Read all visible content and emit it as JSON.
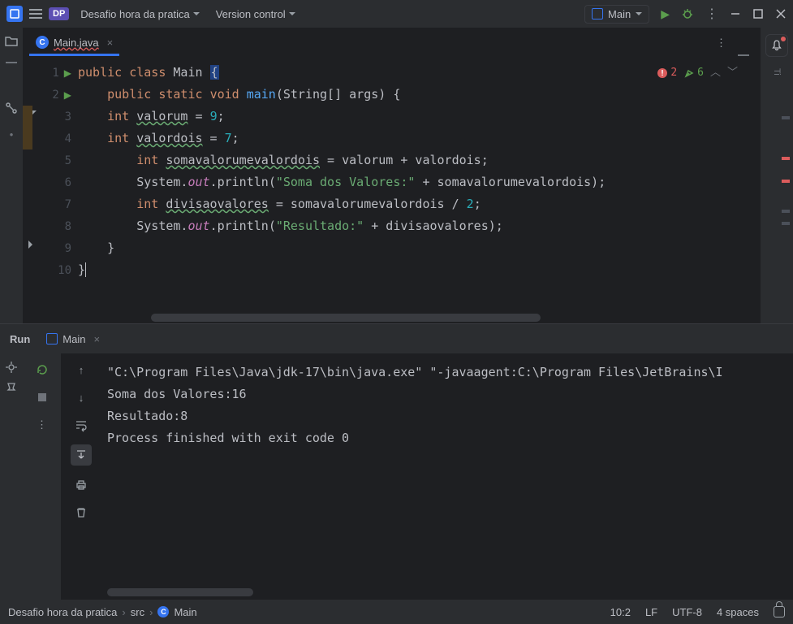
{
  "titlebar": {
    "project_badge": "DP",
    "project_name": "Desafio hora da pratica",
    "version_control": "Version control",
    "run_config": "Main"
  },
  "editor": {
    "tab_name": "Main.java",
    "inspection": {
      "errors": "2",
      "warnings": "6"
    },
    "ti_label": "Ti",
    "lines": [
      {
        "n": "1",
        "run": true
      },
      {
        "n": "2",
        "run": true
      },
      {
        "n": "3"
      },
      {
        "n": "4"
      },
      {
        "n": "5"
      },
      {
        "n": "6"
      },
      {
        "n": "7"
      },
      {
        "n": "8"
      },
      {
        "n": "9"
      },
      {
        "n": "10"
      }
    ],
    "code": {
      "l1": {
        "kw1": "public",
        "kw2": "class",
        "cls": "Main",
        "br": "{"
      },
      "l2": {
        "kw1": "public",
        "kw2": "static",
        "kw3": "void",
        "mth": "main",
        "sig": "(String[] args) {"
      },
      "l3": {
        "kw": "int",
        "var": "valorum",
        "eq": " = ",
        "num": "9",
        "sc": ";"
      },
      "l4": {
        "kw": "int",
        "var": "valordois",
        "eq": " = ",
        "num": "7",
        "sc": ";"
      },
      "l5": {
        "kw": "int",
        "var": "somavalorumevalordois",
        "eq": " = valorum + valordois;"
      },
      "l6": {
        "sys": "System.",
        "out": "out",
        "dot": ".",
        "pl": "println",
        "op": "(",
        "str": "\"Soma dos Valores:\"",
        "rest": " + somavalorumevalordois);"
      },
      "l7": {
        "kw": "int",
        "var": "divisaovalores",
        "eq": " = somavalorumevalordois / ",
        "num": "2",
        "sc": ";"
      },
      "l8": {
        "sys": "System.",
        "out": "out",
        "dot": ".",
        "pl": "println",
        "op": "(",
        "str": "\"Resultado:\"",
        "rest": " + divisaovalores);"
      },
      "l9": {
        "br": "}"
      },
      "l10": {
        "br": "}"
      }
    }
  },
  "run_panel": {
    "title": "Run",
    "tab": "Main",
    "output": [
      "\"C:\\Program Files\\Java\\jdk-17\\bin\\java.exe\" \"-javaagent:C:\\Program Files\\JetBrains\\I",
      "Soma dos Valores:16",
      "Resultado:8",
      "",
      "Process finished with exit code 0"
    ]
  },
  "statusbar": {
    "crumbs": [
      "Desafio hora da pratica",
      "src",
      "Main"
    ],
    "pos": "10:2",
    "lf": "LF",
    "enc": "UTF-8",
    "indent": "4 spaces"
  }
}
